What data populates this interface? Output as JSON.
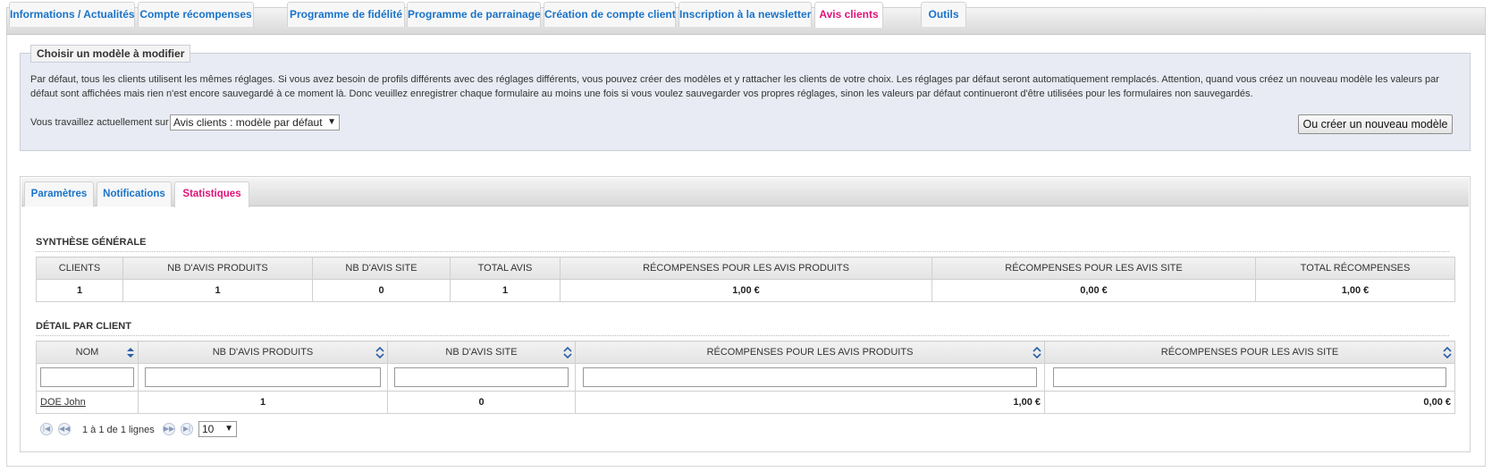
{
  "top_tabs": [
    {
      "label": "Informations / Actualités",
      "active": false
    },
    {
      "label": "Compte récompenses",
      "active": false
    },
    {
      "label": "Programme de fidélité",
      "active": false
    },
    {
      "label": "Programme de parrainage",
      "active": false
    },
    {
      "label": "Création de compte client",
      "active": false
    },
    {
      "label": "Inscription à la newsletter",
      "active": false
    },
    {
      "label": "Avis clients",
      "active": true
    },
    {
      "label": "Outils",
      "active": false
    }
  ],
  "model_box": {
    "legend": "Choisir un modèle à modifier",
    "description": "Par défaut, tous les clients utilisent les mêmes réglages. Si vous avez besoin de profils différents avec des réglages différents, vous pouvez créer des modèles et y rattacher les clients de votre choix. Les réglages par défaut seront automatiquement remplacés. Attention, quand vous créez un nouveau modèle les valeurs par défaut sont affichées mais rien n'est encore sauvegardé à ce moment là. Donc veuillez enregistrer chaque formulaire au moins une fois si vous voulez sauvegarder vos propres réglages, sinon les valeurs par défaut continueront d'être utilisées pour les formulaires non sauvegardés.",
    "working_label": "Vous travaillez actuellement sur",
    "selected_model": "Avis clients : modèle par défaut",
    "create_button": "Ou créer un nouveau modèle"
  },
  "sub_tabs": [
    {
      "label": "Paramètres",
      "active": false
    },
    {
      "label": "Notifications",
      "active": false
    },
    {
      "label": "Statistiques",
      "active": true
    }
  ],
  "summary": {
    "title": "SYNTHÈSE GÉNÉRALE",
    "headers": [
      "CLIENTS",
      "NB D'AVIS PRODUITS",
      "NB D'AVIS SITE",
      "TOTAL AVIS",
      "RÉCOMPENSES POUR LES AVIS PRODUITS",
      "RÉCOMPENSES POUR LES AVIS SITE",
      "TOTAL RÉCOMPENSES"
    ],
    "row": [
      "1",
      "1",
      "0",
      "1",
      "1,00 €",
      "0,00 €",
      "1,00 €"
    ]
  },
  "detail": {
    "title": "DÉTAIL PAR CLIENT",
    "headers": [
      "NOM",
      "NB D'AVIS PRODUITS",
      "NB D'AVIS SITE",
      "RÉCOMPENSES POUR LES AVIS PRODUITS",
      "RÉCOMPENSES POUR LES AVIS SITE"
    ],
    "rows": [
      [
        "DOE John",
        "1",
        "0",
        "1,00 €",
        "0,00 €"
      ]
    ]
  },
  "pager": {
    "text": "1 à 1 de 1 lignes",
    "page_size": "10"
  },
  "colors": {
    "link_blue": "#1a73c9",
    "active_pink": "#e0137a",
    "box_bg": "#e8ebf3"
  }
}
